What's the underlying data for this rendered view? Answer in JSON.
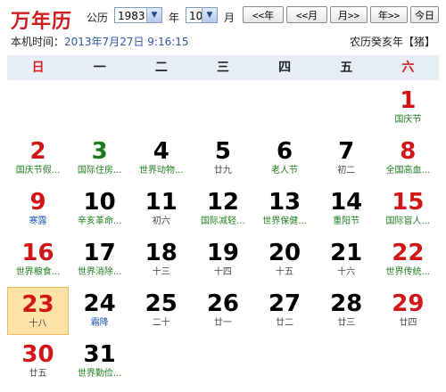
{
  "header": {
    "title": "万年历",
    "calendar_type": "公历",
    "year_value": "1983",
    "year_label": "年",
    "month_value": "10",
    "month_label": "月",
    "btn_prev_year": "<<年",
    "btn_prev_month": "<<月",
    "btn_next_month": "月>>",
    "btn_next_year": "年>>",
    "btn_today": "今日",
    "local_time_label": "本机时间：",
    "local_time": "2013年7月27日 9:16:15",
    "lunar_year": "农历癸亥年【猪】"
  },
  "weekdays": [
    "日",
    "一",
    "二",
    "三",
    "四",
    "五",
    "六"
  ],
  "days": [
    {
      "day": "1",
      "sub": "国庆节",
      "col": 6,
      "row": 0,
      "day_color": "red",
      "sub_color": "green"
    },
    {
      "day": "2",
      "sub": "国庆节假...",
      "col": 0,
      "row": 1,
      "day_color": "red",
      "sub_color": "green"
    },
    {
      "day": "3",
      "sub": "国际住房...",
      "col": 1,
      "row": 1,
      "day_color": "green",
      "sub_color": "green"
    },
    {
      "day": "4",
      "sub": "世界动物...",
      "col": 2,
      "row": 1,
      "day_color": "black",
      "sub_color": "green"
    },
    {
      "day": "5",
      "sub": "廿九",
      "col": 3,
      "row": 1,
      "day_color": "black",
      "sub_color": "gray"
    },
    {
      "day": "6",
      "sub": "老人节",
      "col": 4,
      "row": 1,
      "day_color": "black",
      "sub_color": "green"
    },
    {
      "day": "7",
      "sub": "初二",
      "col": 5,
      "row": 1,
      "day_color": "black",
      "sub_color": "gray"
    },
    {
      "day": "8",
      "sub": "全国高血...",
      "col": 6,
      "row": 1,
      "day_color": "red",
      "sub_color": "green"
    },
    {
      "day": "9",
      "sub": "寒露",
      "col": 0,
      "row": 2,
      "day_color": "red",
      "sub_color": "blue"
    },
    {
      "day": "10",
      "sub": "辛亥革命...",
      "col": 1,
      "row": 2,
      "day_color": "black",
      "sub_color": "green"
    },
    {
      "day": "11",
      "sub": "初六",
      "col": 2,
      "row": 2,
      "day_color": "black",
      "sub_color": "gray"
    },
    {
      "day": "12",
      "sub": "国际减轻...",
      "col": 3,
      "row": 2,
      "day_color": "black",
      "sub_color": "green"
    },
    {
      "day": "13",
      "sub": "世界保健...",
      "col": 4,
      "row": 2,
      "day_color": "black",
      "sub_color": "green"
    },
    {
      "day": "14",
      "sub": "重阳节",
      "col": 5,
      "row": 2,
      "day_color": "black",
      "sub_color": "green"
    },
    {
      "day": "15",
      "sub": "国际盲人...",
      "col": 6,
      "row": 2,
      "day_color": "red",
      "sub_color": "green"
    },
    {
      "day": "16",
      "sub": "世界粮食...",
      "col": 0,
      "row": 3,
      "day_color": "red",
      "sub_color": "green"
    },
    {
      "day": "17",
      "sub": "世界消除...",
      "col": 1,
      "row": 3,
      "day_color": "black",
      "sub_color": "green"
    },
    {
      "day": "18",
      "sub": "十三",
      "col": 2,
      "row": 3,
      "day_color": "black",
      "sub_color": "gray"
    },
    {
      "day": "19",
      "sub": "十四",
      "col": 3,
      "row": 3,
      "day_color": "black",
      "sub_color": "gray"
    },
    {
      "day": "20",
      "sub": "十五",
      "col": 4,
      "row": 3,
      "day_color": "black",
      "sub_color": "gray"
    },
    {
      "day": "21",
      "sub": "十六",
      "col": 5,
      "row": 3,
      "day_color": "black",
      "sub_color": "gray"
    },
    {
      "day": "22",
      "sub": "世界传统...",
      "col": 6,
      "row": 3,
      "day_color": "red",
      "sub_color": "green"
    },
    {
      "day": "23",
      "sub": "十八",
      "col": 0,
      "row": 4,
      "day_color": "red",
      "sub_color": "gray",
      "today": true
    },
    {
      "day": "24",
      "sub": "霜降",
      "col": 1,
      "row": 4,
      "day_color": "black",
      "sub_color": "blue"
    },
    {
      "day": "25",
      "sub": "二十",
      "col": 2,
      "row": 4,
      "day_color": "black",
      "sub_color": "gray"
    },
    {
      "day": "26",
      "sub": "廿一",
      "col": 3,
      "row": 4,
      "day_color": "black",
      "sub_color": "gray"
    },
    {
      "day": "27",
      "sub": "廿二",
      "col": 4,
      "row": 4,
      "day_color": "black",
      "sub_color": "gray"
    },
    {
      "day": "28",
      "sub": "廿三",
      "col": 5,
      "row": 4,
      "day_color": "black",
      "sub_color": "gray"
    },
    {
      "day": "29",
      "sub": "廿四",
      "col": 6,
      "row": 4,
      "day_color": "red",
      "sub_color": "gray"
    },
    {
      "day": "30",
      "sub": "廿五",
      "col": 0,
      "row": 5,
      "day_color": "red",
      "sub_color": "gray"
    },
    {
      "day": "31",
      "sub": "世界勤俭...",
      "col": 1,
      "row": 5,
      "day_color": "black",
      "sub_color": "green"
    }
  ],
  "colors": {
    "red": "#d01616",
    "green": "#1c7a1c",
    "blue": "#1f57b8",
    "today_bg": "#ffe2a6",
    "header_bg": "#e8eef7"
  }
}
